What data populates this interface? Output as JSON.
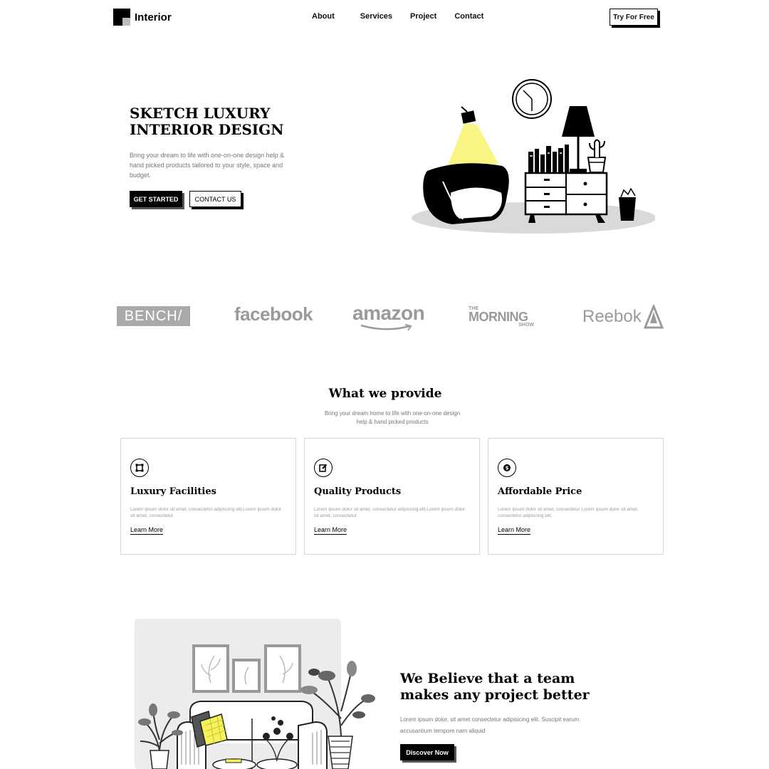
{
  "brand": {
    "name": "Interior"
  },
  "nav": {
    "items": [
      {
        "label": "About"
      },
      {
        "label": "Services"
      },
      {
        "label": "Project"
      },
      {
        "label": "Contact"
      }
    ],
    "cta_label": "Try For Free"
  },
  "hero": {
    "title": "SKETCH LUXURY INTERIOR DESIGN",
    "description": "Bring your dream to life with one-on-one design help & hand picked products tailored to your style, space and budget.",
    "primary_button": "GET STARTED",
    "secondary_button": "CONTACT US"
  },
  "partners": {
    "logos": [
      {
        "text": "BENCH/",
        "icon": "bench-logo"
      },
      {
        "text": "facebook",
        "icon": "facebook-logo"
      },
      {
        "text": "amazon",
        "icon": "amazon-logo"
      },
      {
        "text_top": "THE",
        "text_main": "MORNING",
        "text_bottom": "SHOW",
        "icon": "morning-show-logo"
      },
      {
        "text": "Reebok",
        "icon": "reebok-logo"
      }
    ]
  },
  "services": {
    "title": "What we provide",
    "subtitle": "Bring your dream home to life with one-on-one design help & hand picked products",
    "cards": [
      {
        "icon": "frame-icon",
        "title": "Luxury Facilities",
        "text": "Lorem ipsum dolor sit amet, consectetur adipiscing elit.Lorem ipsum dolor sit amet, consectetur",
        "link": "Learn More"
      },
      {
        "icon": "edit-icon",
        "title": "Quality Products",
        "text": "Lorem ipsum dolor sit amet, consectetur adipiscing elit.Lorem ipsum dolor sit amet, consectetur",
        "link": "Learn More"
      },
      {
        "icon": "dollar-icon",
        "title": "Affordable Price",
        "text": "Lorem ipsum dolor sit amet, consectetur Lorem ipsum dolor sit amet, consectetur adipiscing elit,",
        "link": "Learn More"
      }
    ]
  },
  "about": {
    "title": "We Believe that a team makes any project better",
    "description": "Lorem ipsum dolor, sit amet consectetur adipisicing elit. Suscipit earum accusantium tempore nam aliquid",
    "button": "Discover Now"
  },
  "colors": {
    "primary": "#000000",
    "accent_light": "#f5f25a",
    "muted_text": "#777777",
    "logo_gray": "#9a9a9a",
    "card_border": "#d8d8d8"
  }
}
